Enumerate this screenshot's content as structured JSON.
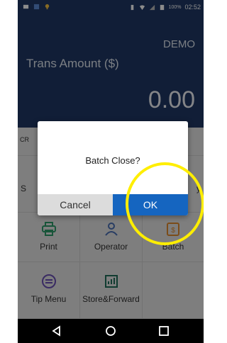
{
  "status_bar": {
    "battery": "100%",
    "time": "02:52"
  },
  "header": {
    "demo_label": "DEMO",
    "trans_label": "Trans Amount ($)",
    "amount": "0.00"
  },
  "grid": {
    "row1_partial": "CR",
    "row2_left_partial": "S",
    "row2_right_partial": "y",
    "print_label": "Print",
    "operator_label": "Operator",
    "batch_label": "Batch",
    "tip_menu_label": "Tip Menu",
    "store_forward_label": "Store&Forward"
  },
  "dialog": {
    "message": "Batch Close?",
    "cancel_label": "Cancel",
    "ok_label": "OK"
  },
  "colors": {
    "header_bg": "#1f3864",
    "ok_button": "#1565c0",
    "highlight": "#ffee00"
  },
  "icons": [
    "back-icon",
    "home-icon",
    "recents-icon",
    "print-icon",
    "operator-icon",
    "batch-icon",
    "tip-menu-icon",
    "store-forward-icon"
  ]
}
